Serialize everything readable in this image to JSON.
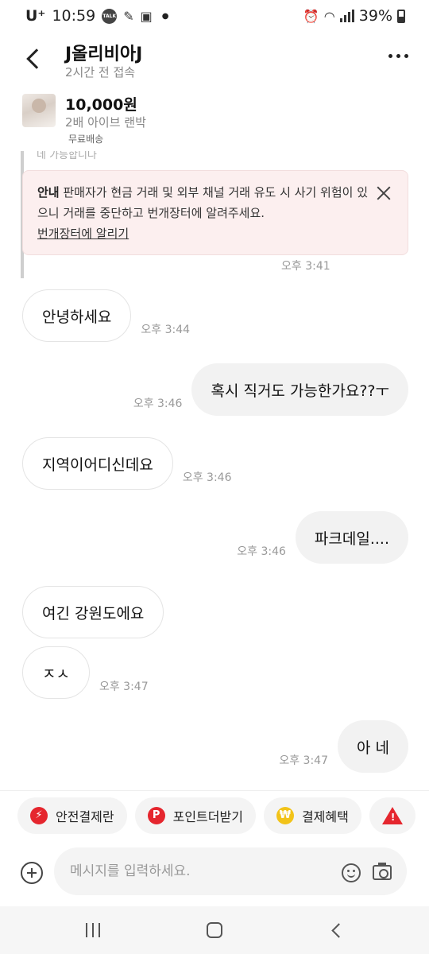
{
  "status_bar": {
    "carrier": "U⁺",
    "time": "10:59",
    "talk_badge": "TALK",
    "battery": "39%",
    "icons": [
      "talk-icon",
      "bird-icon",
      "image-icon",
      "alarm-icon",
      "wifi-icon",
      "signal-icon",
      "battery-icon"
    ]
  },
  "header": {
    "user_name": "J올리비아J",
    "user_status": "2시간 전 접속"
  },
  "product": {
    "price": "10,000원",
    "title": "2배 아이브 랜박",
    "shipping_tag": "무료배송"
  },
  "notice": {
    "partial_text": "네 가능합니다",
    "title": "안내",
    "body": " 판매자가 현금 거래 및 외부 채널 거래 유도 시 사기 위험이 있으니 거래를 중단하고 번개장터에 알려주세요.",
    "link": "번개장터에 알리기",
    "time": "오후 3:41"
  },
  "messages": [
    {
      "direction": "in",
      "text": "안녕하세요",
      "time": "오후 3:44"
    },
    {
      "direction": "out",
      "text": "혹시 직거도 가능한가요??ㅜ",
      "time": "오후 3:46"
    },
    {
      "direction": "in",
      "text": "지역이어디신데요",
      "time": "오후 3:46"
    },
    {
      "direction": "out",
      "text": "파크데일....",
      "time": "오후 3:46"
    },
    {
      "direction": "in",
      "text": "여긴 강원도에요",
      "time": ""
    },
    {
      "direction": "in",
      "text": "ㅈㅅ",
      "time": "오후 3:47"
    },
    {
      "direction": "out",
      "text": "아 네",
      "time": "오후 3:47"
    }
  ],
  "quick_actions": [
    {
      "label": "안전결제란",
      "icon": "lightning-icon",
      "color": "#e5262e"
    },
    {
      "label": "포인트더받기",
      "icon": "point-icon",
      "color": "#e5262e"
    },
    {
      "label": "결제혜택",
      "icon": "won-icon",
      "color": "#f2c319"
    },
    {
      "label": "",
      "icon": "warning-icon",
      "color": "#e5262e"
    }
  ],
  "icon_glyphs": {
    "point": "P",
    "won": "₩",
    "warning": "!",
    "lightning": "⚡"
  },
  "input": {
    "placeholder": "메시지를 입력하세요."
  }
}
